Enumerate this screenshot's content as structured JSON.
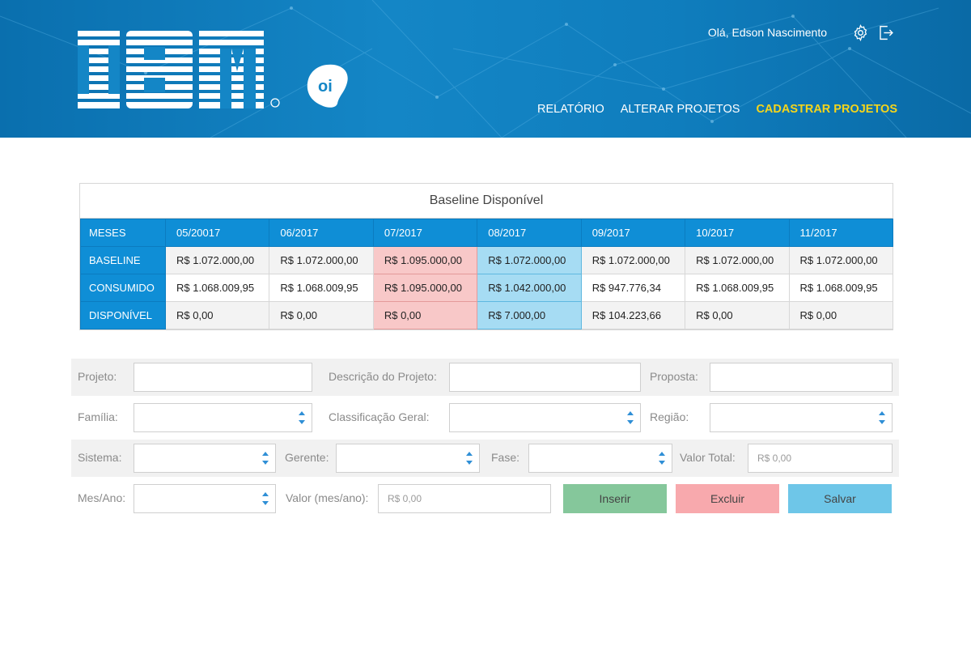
{
  "header": {
    "greeting": "Olá, Edson Nascimento",
    "brand_logo": "IBM",
    "partner_logo": "oi",
    "icons": [
      "gear-icon",
      "logout-icon"
    ],
    "nav": [
      {
        "label": "RELATÓRIO",
        "active": false
      },
      {
        "label": "ALTERAR PROJETOS",
        "active": false
      },
      {
        "label": "CADASTRAR PROJETOS",
        "active": true
      }
    ],
    "colors": {
      "background": "#1486c6",
      "active_nav": "#f5d51b"
    }
  },
  "baseline": {
    "title": "Baseline Disponível",
    "corner_header": "MESES",
    "months": [
      "05/20017",
      "06/2017",
      "07/2017",
      "08/2017",
      "09/2017",
      "10/2017",
      "11/2017"
    ],
    "rows": [
      {
        "label": "BASELINE",
        "values": [
          "R$ 1.072.000,00",
          "R$ 1.072.000,00",
          "R$ 1.095.000,00",
          "R$ 1.072.000,00",
          "R$ 1.072.000,00",
          "R$ 1.072.000,00",
          "R$ 1.072.000,00"
        ]
      },
      {
        "label": "CONSUMIDO",
        "values": [
          "R$ 1.068.009,95",
          "R$ 1.068.009,95",
          "R$ 1.095.000,00",
          "R$ 1.042.000,00",
          "R$ 947.776,34",
          "R$ 1.068.009,95",
          "R$ 1.068.009,95"
        ]
      },
      {
        "label": "DISPONÍVEL",
        "values": [
          "R$ 0,00",
          "R$ 0,00",
          "R$ 0,00",
          "R$ 7.000,00",
          "R$ 104.223,66",
          "R$ 0,00",
          "R$ 0,00"
        ]
      }
    ],
    "highlight": {
      "red_column": "07/2017",
      "blue_column": "08/2017",
      "red_color": "#f8c8c8",
      "blue_color": "#a6dcf3"
    }
  },
  "form": {
    "projeto_label": "Projeto:",
    "descricao_label": "Descrição do Projeto:",
    "proposta_label": "Proposta:",
    "familia_label": "Família:",
    "classificacao_label": "Classificação Geral:",
    "regiao_label": "Região:",
    "sistema_label": "Sistema:",
    "gerente_label": "Gerente:",
    "fase_label": "Fase:",
    "valor_total_label": "Valor Total:",
    "valor_total_placeholder": "R$ 0,00",
    "mes_ano_label": "Mes/Ano:",
    "valor_mes_label": "Valor (mes/ano):",
    "valor_mes_placeholder": "R$ 0,00",
    "buttons": {
      "inserir": "Inserir",
      "excluir": "Excluir",
      "salvar": "Salvar"
    },
    "button_colors": {
      "inserir": "#85c79b",
      "excluir": "#f8a9ad",
      "salvar": "#6ec6e8"
    }
  }
}
